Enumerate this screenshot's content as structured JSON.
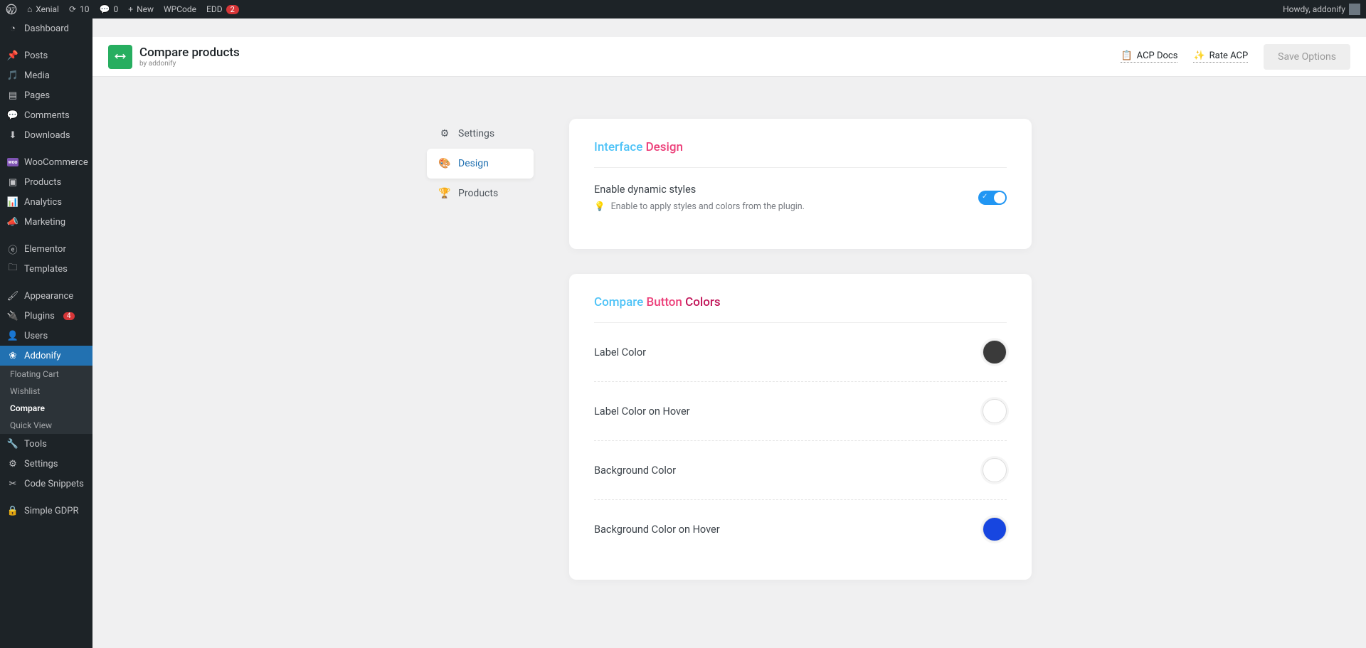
{
  "adminbar": {
    "site": "Xenial",
    "updates": "10",
    "comments": "0",
    "new": "New",
    "wpcode": "WPCode",
    "edd": "EDD",
    "edd_badge": "2",
    "howdy": "Howdy, addonify"
  },
  "sidebar": {
    "dashboard": "Dashboard",
    "posts": "Posts",
    "media": "Media",
    "pages": "Pages",
    "comments": "Comments",
    "downloads": "Downloads",
    "woocommerce": "WooCommerce",
    "products": "Products",
    "analytics": "Analytics",
    "marketing": "Marketing",
    "elementor": "Elementor",
    "templates": "Templates",
    "appearance": "Appearance",
    "plugins": "Plugins",
    "plugins_badge": "4",
    "users": "Users",
    "addonify": "Addonify",
    "submenu": {
      "floating_cart": "Floating Cart",
      "wishlist": "Wishlist",
      "compare": "Compare",
      "quick_view": "Quick View"
    },
    "tools": "Tools",
    "settings": "Settings",
    "code_snippets": "Code Snippets",
    "simple_gdpr": "Simple GDPR"
  },
  "header": {
    "title": "Compare products",
    "subtitle": "by addonify",
    "docs": "ACP Docs",
    "rate": "Rate ACP",
    "save": "Save Options"
  },
  "tabs": {
    "settings": "Settings",
    "design": "Design",
    "products": "Products"
  },
  "panels": {
    "interface": {
      "title_a": "Interface ",
      "title_b": "Design",
      "enable_label": "Enable dynamic styles",
      "enable_desc": "Enable to apply styles and colors from the plugin."
    },
    "colors": {
      "title_a": "Compare ",
      "title_b": "Button ",
      "title_c": "Colors",
      "label_color": "Label Color",
      "label_color_val": "#3a3a3a",
      "label_hover": "Label Color on Hover",
      "label_hover_val": "#ffffff",
      "bg": "Background Color",
      "bg_val": "#ffffff",
      "bg_hover": "Background Color on Hover",
      "bg_hover_val": "#1746e0"
    }
  }
}
